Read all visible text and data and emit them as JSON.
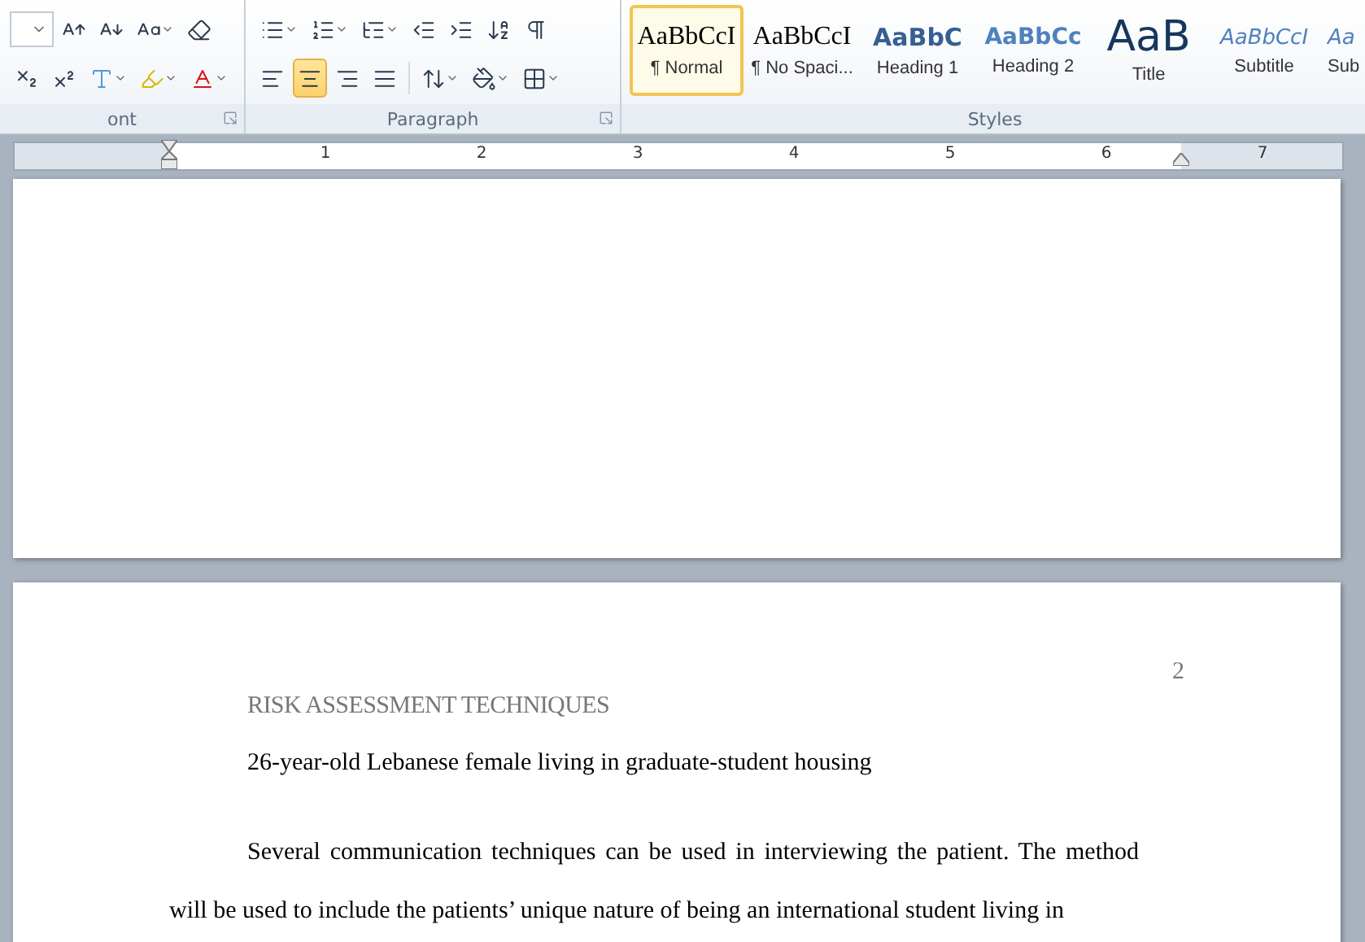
{
  "ribbon": {
    "font_group": {
      "label": "ont",
      "buttons": [
        {
          "kind": "grow"
        },
        {
          "kind": "shrink"
        },
        {
          "kind": "case"
        },
        {
          "kind": "clear"
        }
      ],
      "format_buttons": [
        {
          "kind": "subscript"
        },
        {
          "kind": "superscript"
        },
        {
          "kind": "effects"
        },
        {
          "kind": "highlight"
        },
        {
          "kind": "color"
        }
      ]
    },
    "paragraph_group": {
      "label": "Paragraph",
      "list_buttons": [
        {
          "kind": "bullets"
        },
        {
          "kind": "numbering"
        },
        {
          "kind": "multilevel"
        },
        {
          "kind": "outdent"
        },
        {
          "kind": "indent"
        },
        {
          "kind": "sort"
        },
        {
          "kind": "marks"
        }
      ],
      "alignment": [
        {
          "kind": "left",
          "selected": false
        },
        {
          "kind": "center",
          "selected": true
        },
        {
          "kind": "right",
          "selected": false
        },
        {
          "kind": "justify",
          "selected": false
        }
      ],
      "other_buttons": [
        {
          "kind": "spacing"
        },
        {
          "kind": "shading"
        },
        {
          "kind": "borders"
        }
      ]
    },
    "styles_group": {
      "label": "Styles",
      "styles": [
        {
          "sample": "AaBbCcI",
          "label": "¶ Normal",
          "kind": "normal",
          "selected": true
        },
        {
          "sample": "AaBbCcI",
          "label": "¶ No Spaci...",
          "kind": "normal",
          "selected": false
        },
        {
          "sample": "AaBbC",
          "label": "Heading 1",
          "kind": "heading1",
          "selected": false
        },
        {
          "sample": "AaBbCc",
          "label": "Heading 2",
          "kind": "heading2",
          "selected": false
        },
        {
          "sample": "AaB",
          "label": "Title",
          "kind": "title",
          "selected": false
        },
        {
          "sample": "AaBbCcI",
          "label": "Subtitle",
          "kind": "subtitle",
          "selected": false
        },
        {
          "sample": "Aa",
          "label": "Sub",
          "kind": "subtitle",
          "selected": false
        }
      ]
    }
  },
  "ruler": {
    "numbers": [
      "1",
      "2",
      "3",
      "4",
      "5",
      "6",
      "7"
    ]
  },
  "document": {
    "page_number": "2",
    "running_head": "RISK ASSESSMENT TECHNIQUES",
    "title_line": "26-year-old Lebanese female living in graduate-student housing",
    "paragraph": "Several communication techniques can be used in interviewing the patient. The method will be used to include the patients’ unique nature of being an international student living in"
  }
}
